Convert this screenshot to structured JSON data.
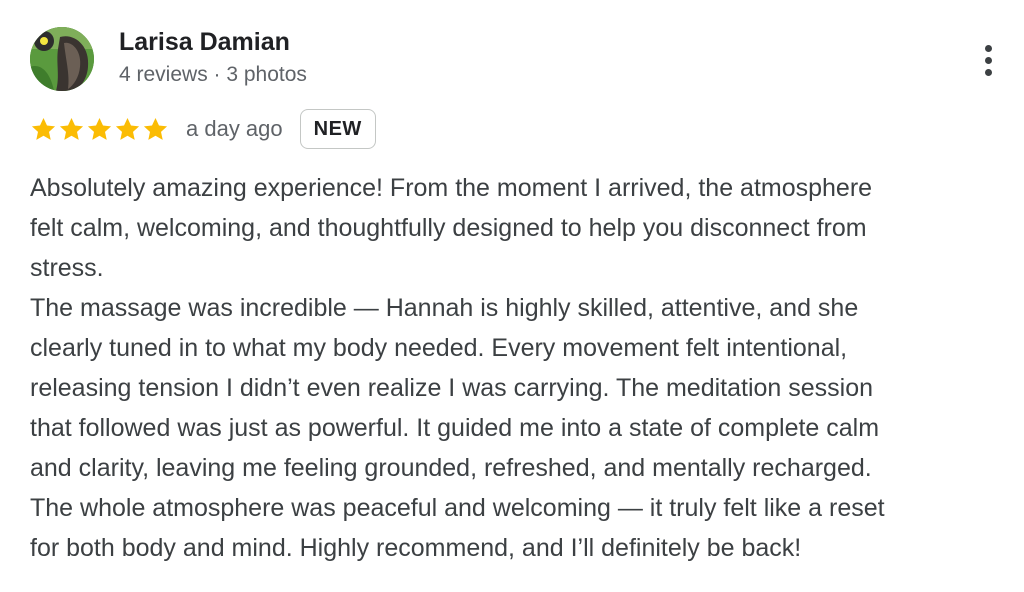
{
  "reviewer": {
    "name": "Larisa Damian",
    "meta": "4 reviews · 3 photos",
    "avatar_icon": "profile-photo"
  },
  "actions": {
    "more_icon": "more-vert-icon"
  },
  "rating": {
    "stars": 5,
    "max_stars": 5,
    "star_color": "#fbbc04",
    "date": "a day ago",
    "badge": "NEW"
  },
  "review_lines": [
    "Absolutely amazing experience! From the moment I arrived, the atmosphere",
    "felt calm, welcoming, and thoughtfully designed to help you disconnect from",
    "stress.",
    "The massage was incredible — Hannah is highly skilled, attentive, and she",
    "clearly tuned in to what my body needed. Every movement felt intentional,",
    "releasing tension I didn’t even realize I was carrying. The meditation session",
    "that followed was just as powerful. It guided me into a state of complete calm",
    "and clarity, leaving me feeling grounded, refreshed, and mentally recharged.",
    "The whole atmosphere was peaceful and welcoming — it truly felt like a reset",
    "for both body and mind. Highly recommend, and I’ll definitely be back!"
  ]
}
